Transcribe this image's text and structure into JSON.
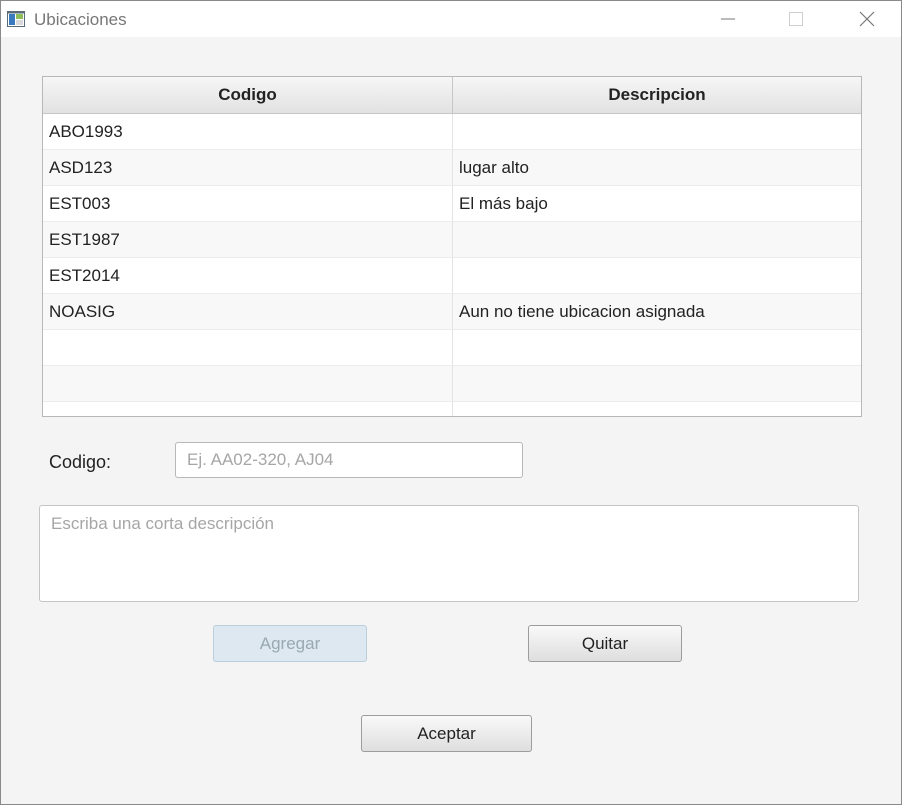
{
  "window": {
    "title": "Ubicaciones",
    "icons": {
      "app": "app-window-icon",
      "minimize": "minimize-icon",
      "maximize": "maximize-icon",
      "close": "close-icon"
    }
  },
  "table": {
    "headers": [
      "Codigo",
      "Descripcion"
    ],
    "rows": [
      [
        "ABO1993",
        ""
      ],
      [
        "ASD123",
        "lugar alto"
      ],
      [
        "EST003",
        "El más bajo"
      ],
      [
        "EST1987",
        ""
      ],
      [
        "EST2014",
        ""
      ],
      [
        "NOASIG",
        "Aun no tiene ubicacion asignada"
      ],
      [
        "",
        ""
      ],
      [
        "",
        ""
      ],
      [
        "",
        ""
      ]
    ]
  },
  "form": {
    "codigo_label": "Codigo:",
    "codigo_value": "",
    "codigo_placeholder": "Ej. AA02-320, AJ04",
    "descripcion_value": "",
    "descripcion_placeholder": "Escriba una corta descripción"
  },
  "buttons": {
    "agregar": "Agregar",
    "quitar": "Quitar",
    "aceptar": "Aceptar"
  },
  "colors": {
    "agregar_disabled_bg": "#dde8f0",
    "window_bg": "#f4f4f4"
  }
}
